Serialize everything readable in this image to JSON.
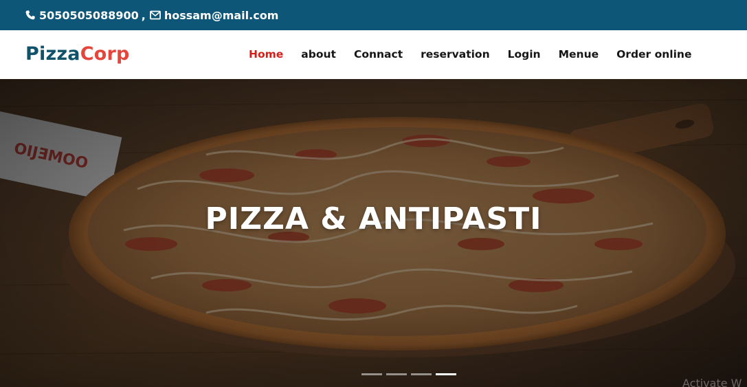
{
  "topbar": {
    "phone_icon": "phone-icon",
    "phone": "5050505088900",
    "separator": ",",
    "mail_icon": "envelope-icon",
    "email": "hossam@mail.com",
    "bg_color": "#0d5677"
  },
  "brand": {
    "part1": "Pizza",
    "part2": "Corp",
    "color1": "#11526b",
    "color2": "#e6453b"
  },
  "nav": {
    "items": [
      {
        "label": "Home",
        "active": true
      },
      {
        "label": "about",
        "active": false
      },
      {
        "label": "Connact",
        "active": false
      },
      {
        "label": "reservation",
        "active": false
      },
      {
        "label": "Login",
        "active": false
      },
      {
        "label": "Menue",
        "active": false
      },
      {
        "label": "Order online",
        "active": false
      }
    ],
    "active_color": "#d21f1a"
  },
  "hero": {
    "title": "PIZZA & ANTIPASTI",
    "slides": 4,
    "active_slide": 4
  },
  "watermark": "Activate W"
}
